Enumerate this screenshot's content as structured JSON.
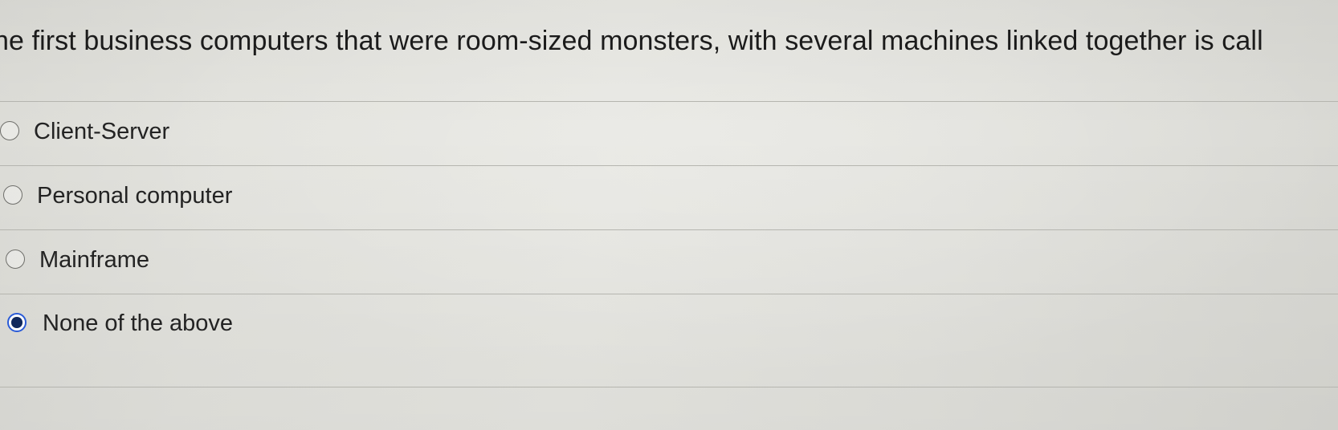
{
  "question": {
    "text": "he first business computers that were room-sized monsters, with several machines linked together is call"
  },
  "options": [
    {
      "label": "Client-Server",
      "selected": false
    },
    {
      "label": "Personal computer",
      "selected": false
    },
    {
      "label": "Mainframe",
      "selected": false
    },
    {
      "label": "None of the above",
      "selected": true
    }
  ],
  "colors": {
    "selected_ring": "#2a5bd7",
    "selected_dot": "#10285c",
    "divider": "#b5b5af"
  }
}
